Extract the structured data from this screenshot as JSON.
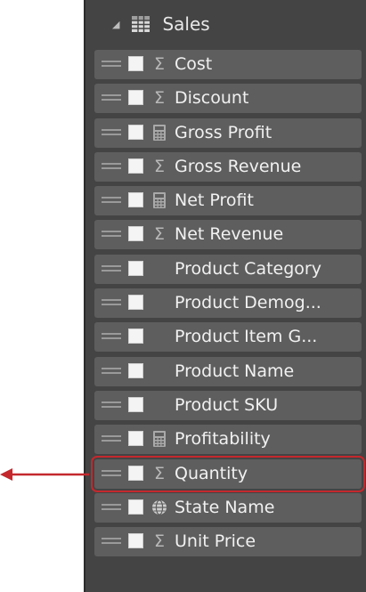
{
  "header": {
    "caret_icon": "collapse-caret-icon",
    "table_icon": "table-grid-icon",
    "title": "Sales"
  },
  "fields": [
    {
      "label": "Cost",
      "icon": "sigma",
      "selected": false
    },
    {
      "label": "Discount",
      "icon": "sigma",
      "selected": false
    },
    {
      "label": "Gross Profit",
      "icon": "calculator",
      "selected": false
    },
    {
      "label": "Gross Revenue",
      "icon": "sigma",
      "selected": false
    },
    {
      "label": "Net Profit",
      "icon": "calculator",
      "selected": false
    },
    {
      "label": "Net Revenue",
      "icon": "sigma",
      "selected": false
    },
    {
      "label": "Product Category",
      "icon": "none",
      "selected": false
    },
    {
      "label": "Product Demog...",
      "icon": "none",
      "selected": false
    },
    {
      "label": "Product Item G...",
      "icon": "none",
      "selected": false
    },
    {
      "label": "Product Name",
      "icon": "none",
      "selected": false
    },
    {
      "label": "Product SKU",
      "icon": "none",
      "selected": false
    },
    {
      "label": "Profitability",
      "icon": "calculator",
      "selected": false
    },
    {
      "label": "Quantity",
      "icon": "sigma",
      "selected": true
    },
    {
      "label": "State Name",
      "icon": "globe",
      "selected": false
    },
    {
      "label": "Unit Price",
      "icon": "sigma",
      "selected": false
    }
  ],
  "colors": {
    "panel": "#444444",
    "field": "#5e5e5e",
    "highlight": "#c4282d"
  },
  "annotation": {
    "arrow_icon": "left-arrow-icon"
  }
}
